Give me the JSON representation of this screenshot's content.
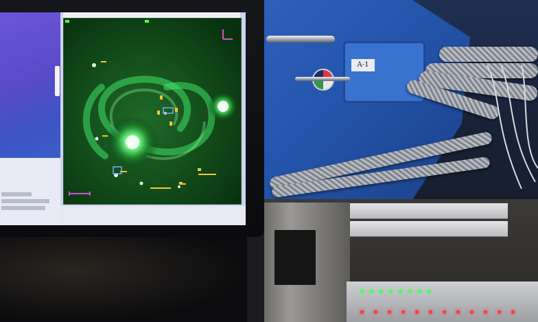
{
  "scene": {
    "description_label": "",
    "hardware_plate_label": "A-1",
    "colors": {
      "galaxy_green": "#3fe06a",
      "screen_purple": "#5a4bc9",
      "telescope_blue": "#2456ad",
      "led_green": "#47ff5a",
      "led_red": "#ff3a3a"
    },
    "icons": {
      "gauge": "pressure-gauge-icon",
      "compass": "compass-arrows-icon"
    }
  }
}
